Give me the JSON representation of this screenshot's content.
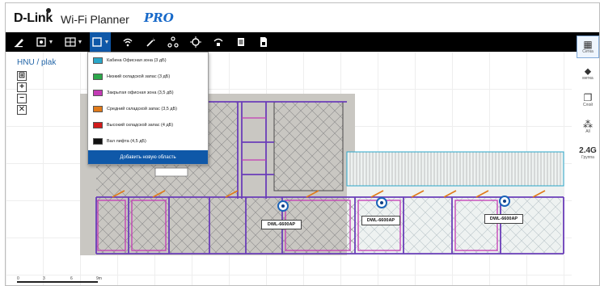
{
  "app": {
    "brand": "D-Link",
    "name": "Wi-Fi Planner",
    "edition": "PRO"
  },
  "toolbar": {
    "tools": [
      {
        "name": "draw-wall-tool",
        "icon": "pen-icon"
      },
      {
        "name": "device-tool",
        "icon": "device-icon"
      },
      {
        "name": "grid-tool",
        "icon": "grid-icon"
      },
      {
        "name": "area-tool",
        "icon": "area-icon",
        "active": true
      },
      {
        "name": "wifi-tool",
        "icon": "wifi-icon"
      },
      {
        "name": "wand-tool",
        "icon": "wand-icon"
      },
      {
        "name": "network-tool",
        "icon": "network-icon"
      },
      {
        "name": "target-tool",
        "icon": "target-icon"
      },
      {
        "name": "signal-tool",
        "icon": "signal-icon"
      },
      {
        "name": "report-tool",
        "icon": "report-icon"
      },
      {
        "name": "export-tool",
        "icon": "export-icon"
      }
    ]
  },
  "breadcrumb": "HNU / plak",
  "zoom": {
    "fit": "⊞",
    "in": "+",
    "out": "−",
    "reset": "✕"
  },
  "area_menu": {
    "items": [
      {
        "label": "Кабина Офисная зона (3 дБ)",
        "color": "#2aa7c9"
      },
      {
        "label": "Низкий складской запас (3 дБ)",
        "color": "#2ca84a"
      },
      {
        "label": "Закрытая офисная зона (3,5 дБ)",
        "color": "#c33bb5"
      },
      {
        "label": "Средний складской запас (3,5 дБ)",
        "color": "#e07a1a"
      },
      {
        "label": "Высокий складской запас (4 дБ)",
        "color": "#d11b1b"
      },
      {
        "label": "Вал лифта (4,5 дБ)",
        "color": "#111111"
      }
    ],
    "add_label": "Добавить новую область"
  },
  "access_points": [
    {
      "label": "DWL-6600AP"
    },
    {
      "label": "DWL-6600AP"
    },
    {
      "label": "DWL-6600AP"
    }
  ],
  "right_panel": [
    {
      "icon": "grid-icon",
      "label": "Сетка",
      "active": true
    },
    {
      "icon": "tag-icon",
      "label": "метка"
    },
    {
      "icon": "layers-icon",
      "label": "Слой"
    },
    {
      "icon": "network-icon",
      "label": "All"
    },
    {
      "icon": "frequency-icon",
      "label": "Группа",
      "text": "2.4G"
    }
  ],
  "scale": {
    "labels": [
      "0",
      "3",
      "6",
      "9m"
    ]
  },
  "colors": {
    "toolbar": "#000000",
    "accent": "#0f58a8",
    "ap": "#1a63b8",
    "wall": "#6a3db8"
  }
}
